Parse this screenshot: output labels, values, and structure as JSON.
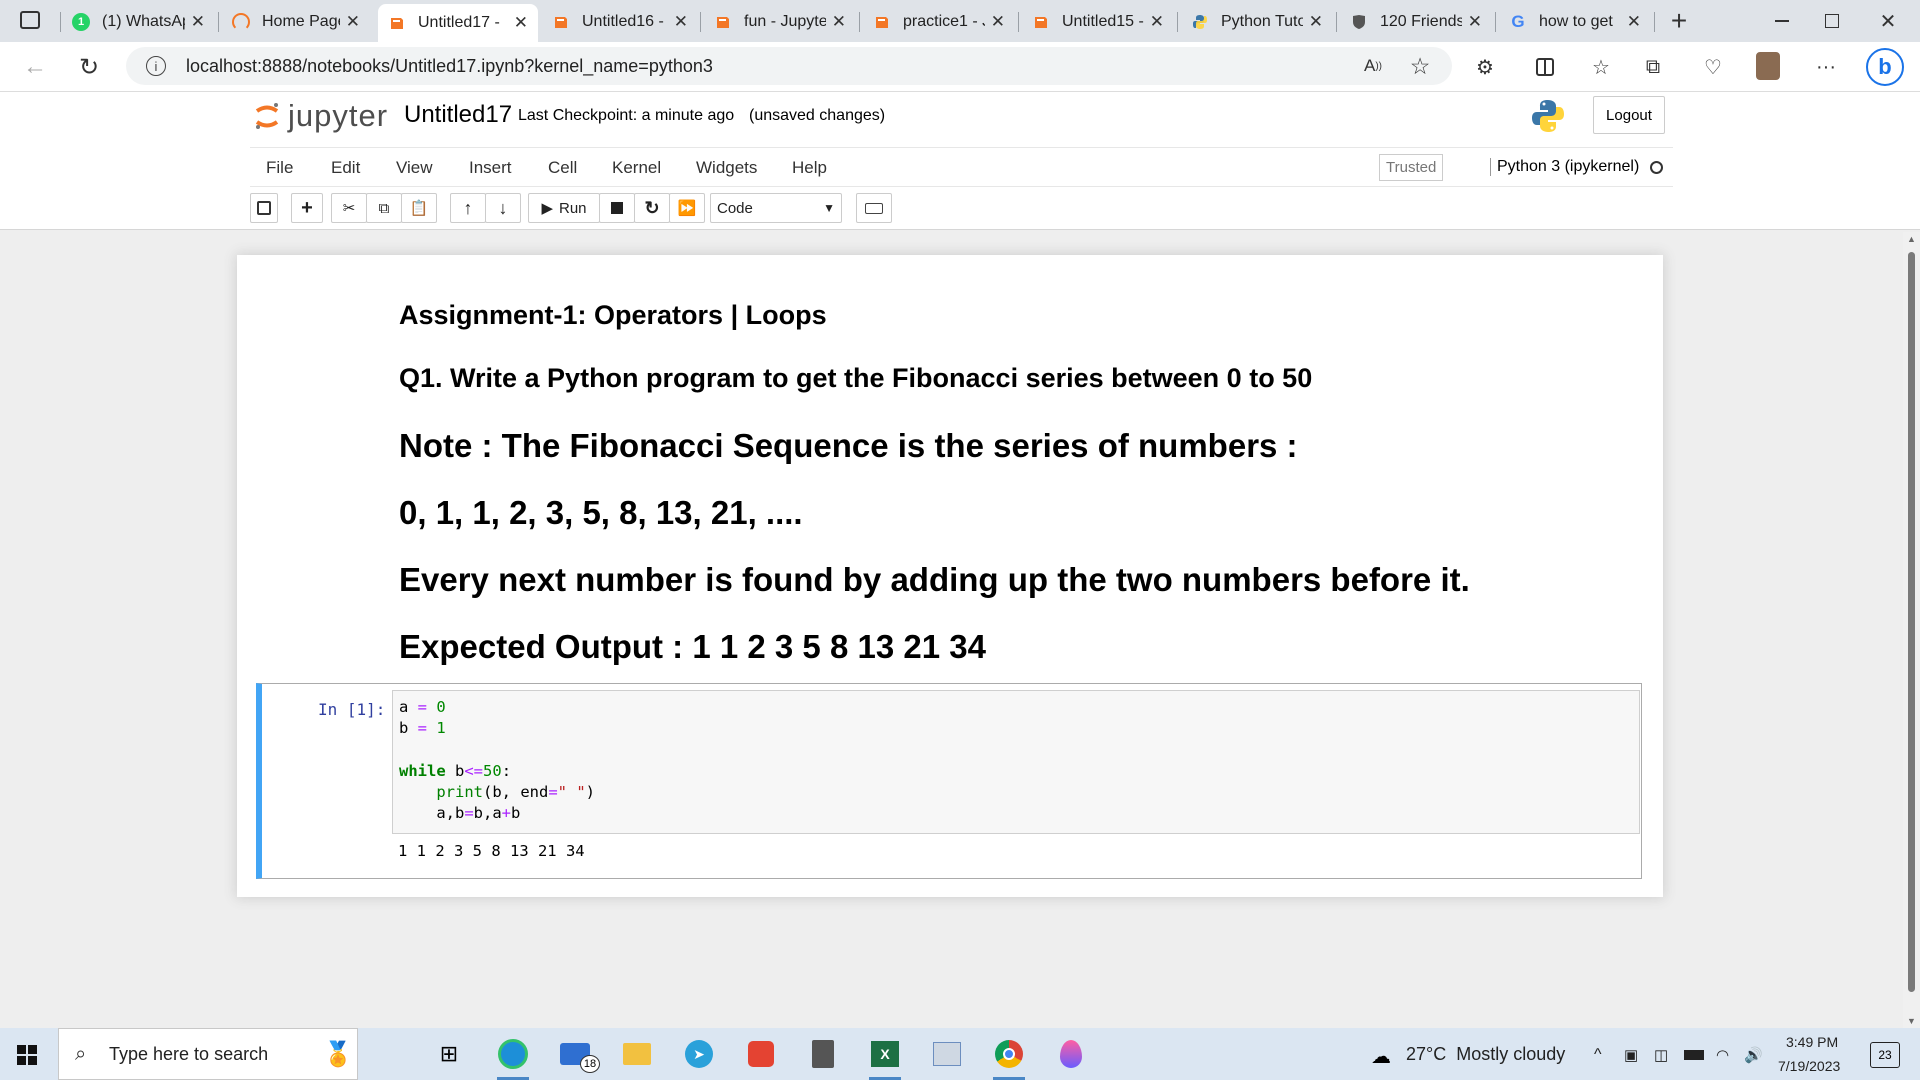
{
  "browser": {
    "tabs": [
      {
        "label": "(1) WhatsAp",
        "icon": "whatsapp-icon"
      },
      {
        "label": "Home Page",
        "icon": "loading-icon"
      },
      {
        "label": "Untitled17 -",
        "icon": "jupyter-icon",
        "active": true
      },
      {
        "label": "Untitled16 -",
        "icon": "jupyter-icon"
      },
      {
        "label": "fun - Jupyte",
        "icon": "jupyter-icon"
      },
      {
        "label": "practice1 - J",
        "icon": "jupyter-icon"
      },
      {
        "label": "Untitled15 -",
        "icon": "jupyter-icon"
      },
      {
        "label": "Python Tuto",
        "icon": "python-icon"
      },
      {
        "label": "120 Friends",
        "icon": "shield-icon"
      },
      {
        "label": "how to get",
        "icon": "google-icon"
      }
    ],
    "url": "localhost:8888/notebooks/Untitled17.ipynb?kernel_name=python3"
  },
  "jupyter": {
    "logo_text": "jupyter",
    "notebook_name": "Untitled17",
    "checkpoint": "Last Checkpoint: a minute ago",
    "save_status": "(unsaved changes)",
    "logout": "Logout",
    "menus": [
      "File",
      "Edit",
      "View",
      "Insert",
      "Cell",
      "Kernel",
      "Widgets",
      "Help"
    ],
    "trusted": "Trusted",
    "kernel": "Python 3 (ipykernel)",
    "run_label": "Run",
    "cell_type": "Code"
  },
  "notebook": {
    "markdown": {
      "h1": "Assignment-1: Operators | Loops",
      "h2": "Q1. Write a Python program to get the Fibonacci series between 0 to 50",
      "note": "Note : The Fibonacci Sequence is the series of numbers :",
      "sequence": "0, 1, 1, 2, 3, 5, 8, 13, 21, ....",
      "rule": "Every next number is found by adding up the two numbers before it.",
      "expected": "Expected Output : 1 1 2 3 5 8 13 21 34"
    },
    "cell": {
      "prompt": "In [1]:",
      "output": "1 1 2 3 5 8 13 21 34"
    }
  },
  "taskbar": {
    "search_placeholder": "Type here to search",
    "mail_badge": "18",
    "weather": "27°C  Mostly cloudy",
    "time": "3:49 PM",
    "date": "7/19/2023",
    "notifications": "23"
  },
  "colors": {
    "accent": "#42a5f5",
    "jupyter_orange": "#f37726",
    "tab_strip": "#dfe3e8"
  }
}
